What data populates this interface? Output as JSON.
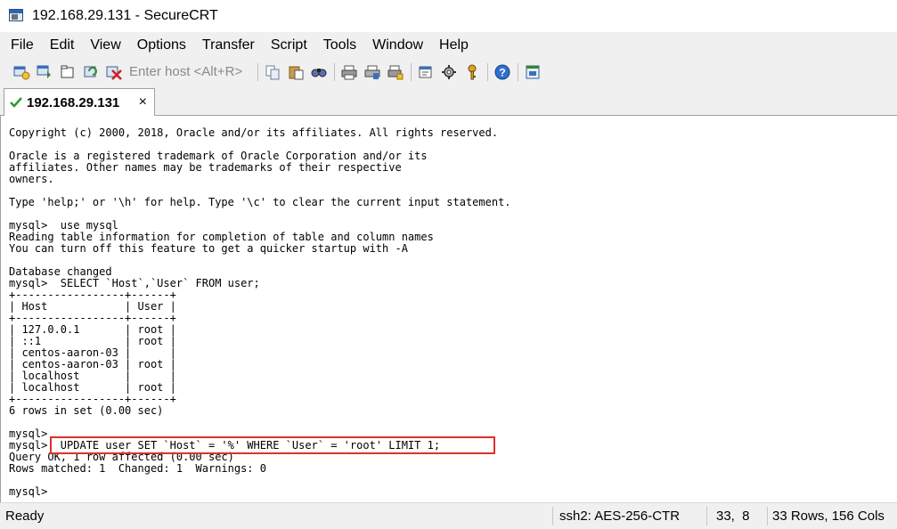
{
  "window": {
    "title": "192.168.29.131 - SecureCRT"
  },
  "menu": [
    "File",
    "Edit",
    "View",
    "Options",
    "Transfer",
    "Script",
    "Tools",
    "Window",
    "Help"
  ],
  "toolbar": {
    "host_placeholder": "Enter host <Alt+R>",
    "icons_left": [
      "connect-icon",
      "quick-connect-icon",
      "connect-in-tab-icon",
      "reconnect-icon",
      "disconnect-icon"
    ],
    "icons_mid": [
      "copy-icon",
      "paste-icon",
      "find-icon"
    ],
    "icons_right": [
      "print-icon",
      "print-selection-icon",
      "print-setup-icon",
      "session-options-icon",
      "global-options-icon",
      "keymap-icon",
      "help-icon",
      "sftp-icon"
    ]
  },
  "tab": {
    "label": "192.168.29.131",
    "close": "×"
  },
  "terminal": {
    "lines": [
      "Copyright (c) 2000, 2018, Oracle and/or its affiliates. All rights reserved.",
      "",
      "Oracle is a registered trademark of Oracle Corporation and/or its",
      "affiliates. Other names may be trademarks of their respective",
      "owners.",
      "",
      "Type 'help;' or '\\h' for help. Type '\\c' to clear the current input statement.",
      "",
      "mysql>  use mysql",
      "Reading table information for completion of table and column names",
      "You can turn off this feature to get a quicker startup with -A",
      "",
      "Database changed",
      "mysql>  SELECT `Host`,`User` FROM user;",
      "+-----------------+------+",
      "| Host            | User |",
      "+-----------------+------+",
      "| 127.0.0.1       | root |",
      "| ::1             | root |",
      "| centos-aaron-03 |      |",
      "| centos-aaron-03 | root |",
      "| localhost       |      |",
      "| localhost       | root |",
      "+-----------------+------+",
      "6 rows in set (0.00 sec)",
      "",
      "mysql>",
      "mysql>  UPDATE user SET `Host` = '%' WHERE `User` = 'root' LIMIT 1;",
      "Query OK, 1 row affected (0.00 sec)",
      "Rows matched: 1  Changed: 1  Warnings: 0",
      "",
      "mysql>"
    ]
  },
  "status": {
    "ready": "Ready",
    "cipher": "ssh2: AES-256-CTR",
    "cursor": "33,  8",
    "size": "33 Rows, 156 Cols"
  },
  "colors": {
    "highlight": "#e0302a",
    "chrome": "#f0f0f0"
  }
}
